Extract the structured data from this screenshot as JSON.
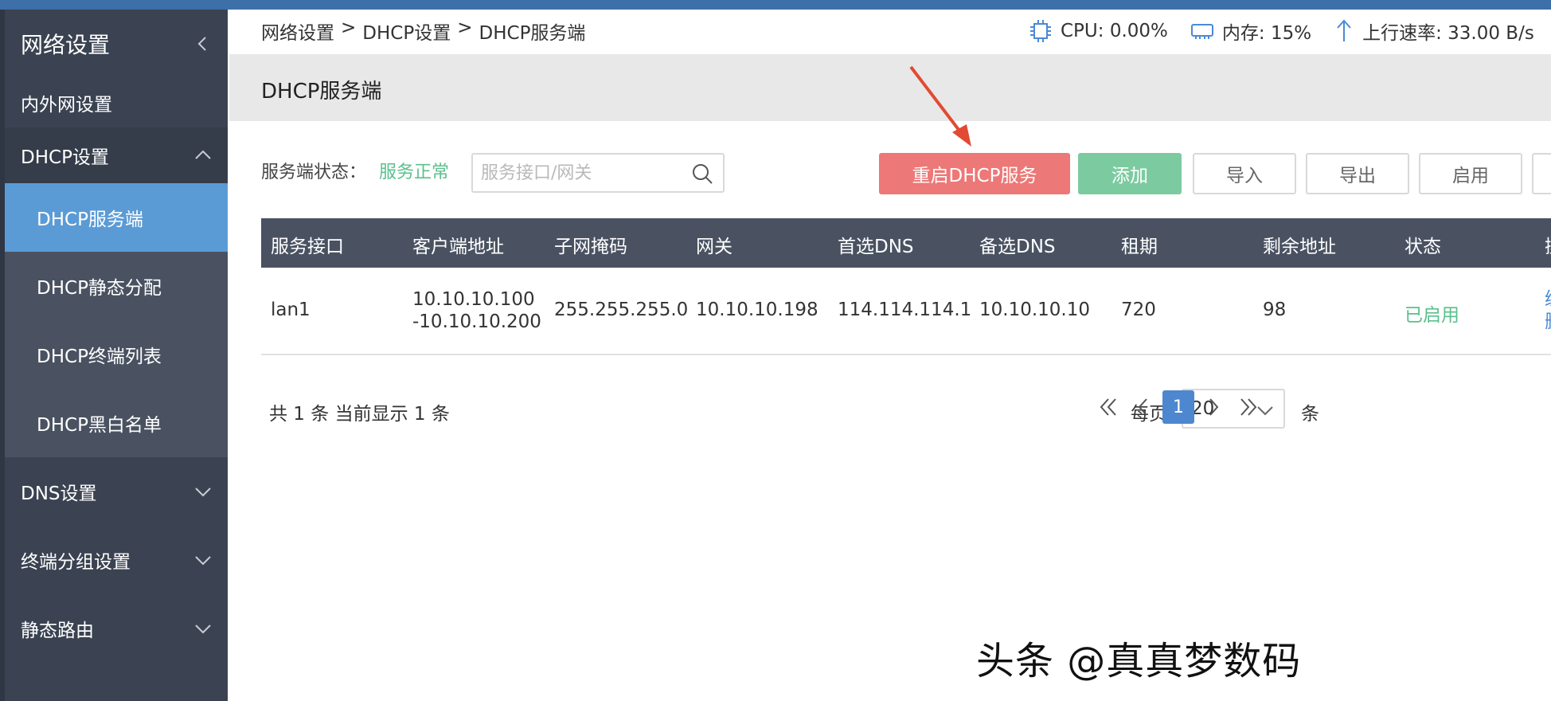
{
  "sidebar": {
    "title": "网络设置",
    "items": [
      {
        "label": "内外网设置"
      },
      {
        "label": "DHCP设置"
      },
      {
        "label": "DHCP服务端"
      },
      {
        "label": "DHCP静态分配"
      },
      {
        "label": "DHCP终端列表"
      },
      {
        "label": "DHCP黑白名单"
      },
      {
        "label": "DNS设置"
      },
      {
        "label": "终端分组设置"
      },
      {
        "label": "静态路由"
      }
    ]
  },
  "breadcrumb": [
    "网络设置",
    ">",
    "DHCP设置",
    ">",
    "DHCP服务端"
  ],
  "stats": {
    "cpu": "CPU: 0.00%",
    "memory": "内存: 15%",
    "upload": "上行速率: 33.00 B/s"
  },
  "page": {
    "title": "DHCP服务端"
  },
  "server_status": {
    "label": "服务端状态：",
    "value": "服务正常"
  },
  "search": {
    "placeholder": "服务接口/网关"
  },
  "toolbar": {
    "restart": "重启DHCP服务",
    "add": "添加",
    "import": "导入",
    "export": "导出",
    "enable": "启用"
  },
  "table": {
    "columns": [
      "服务接口",
      "客户端地址",
      "子网掩码",
      "网关",
      "首选DNS",
      "备选DNS",
      "租期",
      "剩余地址",
      "状态",
      "操"
    ],
    "rows": [
      {
        "interface": "lan1",
        "client_addr_1": "10.10.10.100",
        "client_addr_2": "-10.10.10.200",
        "mask": "255.255.255.0",
        "gateway": "10.10.10.198",
        "dns1": "114.114.114.1",
        "dns2": "10.10.10.10",
        "lease": "720",
        "remaining": "98",
        "status": "已启用",
        "action_1": "编",
        "action_2": "删"
      }
    ]
  },
  "pagination": {
    "summary": "共 1 条 当前显示 1 条",
    "per_page_label": "每页",
    "per_page_value": "20",
    "unit": "条",
    "current_page": "1"
  },
  "watermark": "头条 @真真梦数码",
  "colors": {
    "sidebar_bg": "#3b4352",
    "sidebar_active": "#5b9bd5",
    "restart_button": "#ec7877",
    "add_button": "#7ccba0",
    "status_ok": "#5bc08c",
    "table_header": "#4a5262",
    "annotation_arrow": "#e24a33"
  }
}
